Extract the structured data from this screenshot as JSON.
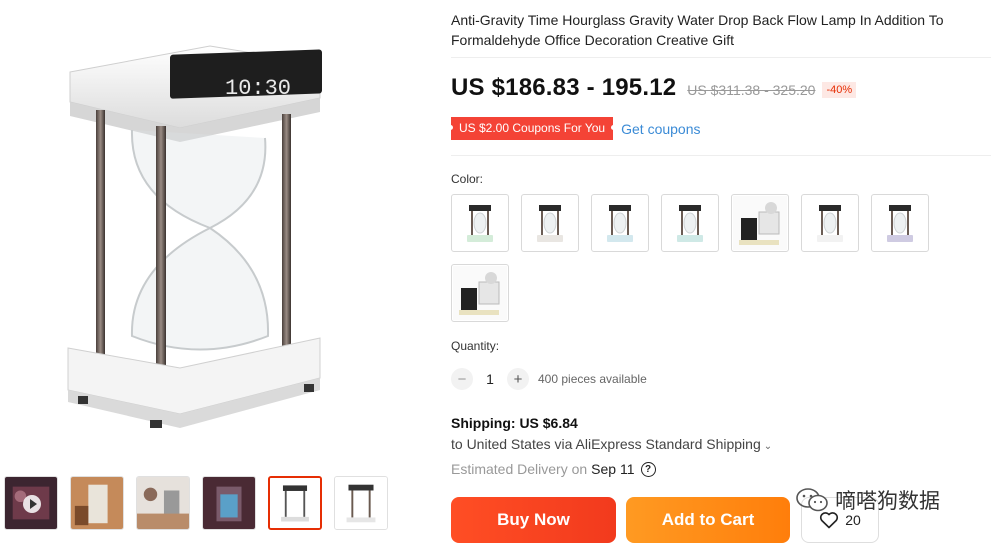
{
  "product": {
    "title": "Anti-Gravity Time Hourglass Gravity Water Drop Back Flow Lamp In Addition To Formaldehyde Office Decoration Creative Gift",
    "price_range": "US $186.83 - 195.12",
    "original_price": "US $311.38 - 325.20",
    "discount": "-40%",
    "coupon": "US $2.00 Coupons For You",
    "get_coupons": "Get coupons",
    "main_image_clock": "10:30"
  },
  "color": {
    "label": "Color:",
    "options": [
      {
        "name": "green",
        "base": "#d4ecd9"
      },
      {
        "name": "white",
        "base": "#e9e6e2"
      },
      {
        "name": "blue",
        "base": "#d3e8ee"
      },
      {
        "name": "mint",
        "base": "#cfe9e6"
      },
      {
        "name": "set-black",
        "base": "#222222"
      },
      {
        "name": "plain-white",
        "base": "#f2f2f2"
      },
      {
        "name": "purple",
        "base": "#cfcbe2"
      },
      {
        "name": "set-gift",
        "base": "#222222"
      }
    ]
  },
  "quantity": {
    "label": "Quantity:",
    "minus": "−",
    "value": "1",
    "plus": "+",
    "available": "400 pieces available"
  },
  "shipping": {
    "label": "Shipping:",
    "cost": "US $6.84",
    "destination": "to United States via AliExpress Standard Shipping",
    "estimated_label": "Estimated Delivery on",
    "estimated_date": "Sep 11",
    "help": "?"
  },
  "actions": {
    "buy_now": "Buy Now",
    "add_to_cart": "Add to Cart",
    "wishlist_count": "20"
  },
  "watermark": {
    "text": "嘀嗒狗数据"
  },
  "colors": {
    "buy_now": "#f23a1d",
    "add_to_cart": "#ff8b14",
    "coupon": "#f44336",
    "link": "#3b8bd6",
    "active_thumb": "#e62e04"
  }
}
